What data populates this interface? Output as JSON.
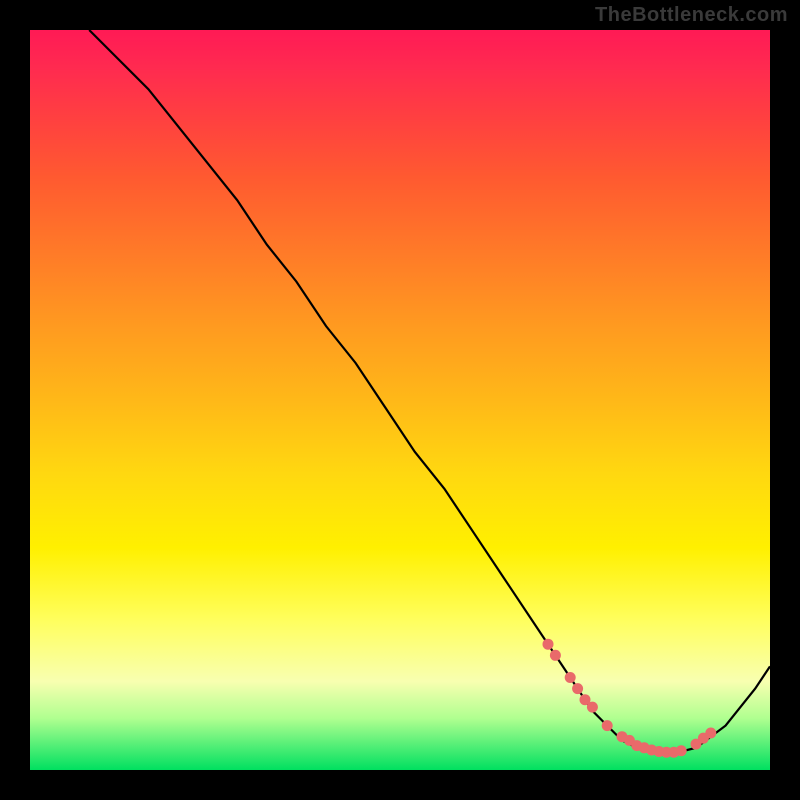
{
  "watermark": "TheBottleneck.com",
  "chart_data": {
    "type": "line",
    "title": "",
    "xlabel": "",
    "ylabel": "",
    "xlim": [
      0,
      100
    ],
    "ylim": [
      0,
      100
    ],
    "series": [
      {
        "name": "main-curve",
        "x": [
          8,
          12,
          16,
          20,
          24,
          28,
          32,
          36,
          40,
          44,
          48,
          52,
          56,
          60,
          64,
          68,
          72,
          74,
          76,
          78,
          80,
          82,
          84,
          86,
          88,
          90,
          94,
          98,
          100
        ],
        "y": [
          100,
          96,
          92,
          87,
          82,
          77,
          71,
          66,
          60,
          55,
          49,
          43,
          38,
          32,
          26,
          20,
          14,
          11,
          8,
          6,
          4,
          3,
          2.5,
          2.3,
          2.5,
          3,
          6,
          11,
          14
        ]
      }
    ],
    "markers": {
      "name": "highlight-points",
      "color": "#e96a6a",
      "x": [
        70,
        71,
        73,
        74,
        75,
        76,
        78,
        80,
        81,
        82,
        83,
        84,
        85,
        86,
        87,
        88,
        90,
        91,
        92
      ],
      "y": [
        17,
        15.5,
        12.5,
        11,
        9.5,
        8.5,
        6,
        4.5,
        4,
        3.3,
        3,
        2.7,
        2.5,
        2.4,
        2.4,
        2.6,
        3.5,
        4.3,
        5
      ]
    }
  }
}
